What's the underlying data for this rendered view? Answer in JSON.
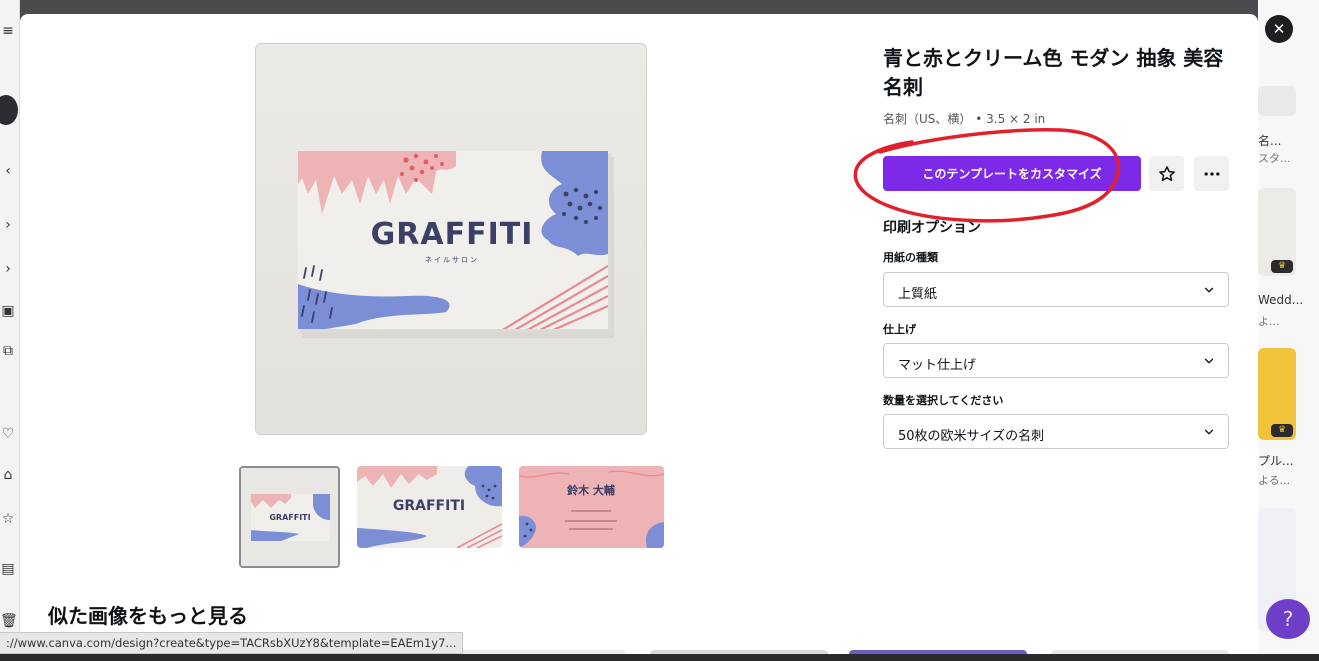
{
  "template": {
    "title": "青と赤とクリーム色 モダン 抽象 美容 名刺",
    "size_label": "名刺（US、横）",
    "size_dims": "• 3.5 × 2 in"
  },
  "actions": {
    "customize_label": "このテンプレートをカスタマイズ"
  },
  "print_options": {
    "section_title": "印刷オプション",
    "paper_label": "用紙の種類",
    "paper_value": "上質紙",
    "finish_label": "仕上げ",
    "finish_value": "マット仕上げ",
    "quantity_label": "数量を選択してください",
    "quantity_value": "50枚の欧米サイズの名刺"
  },
  "card_design": {
    "brand": "GRAFFITI",
    "brand_sub": "ネイルサロン",
    "person_name": "鈴木 大輔"
  },
  "similar": {
    "title": "似た画像をもっと見る"
  },
  "background_right": {
    "items": [
      "名...",
      "スタ...",
      "Wedd...",
      "よ...",
      "プル...",
      "よる..."
    ]
  },
  "status_url": "://www.canva.com/design?create&type=TACRsbXUzY8&template=EAEm1y7...",
  "help_label": "?",
  "colors": {
    "primary": "#7d2ae8",
    "annotation": "#e0202a",
    "card_pink": "#eeb3b5",
    "card_blue": "#7b8ed6",
    "card_navy": "#3c3f66"
  }
}
